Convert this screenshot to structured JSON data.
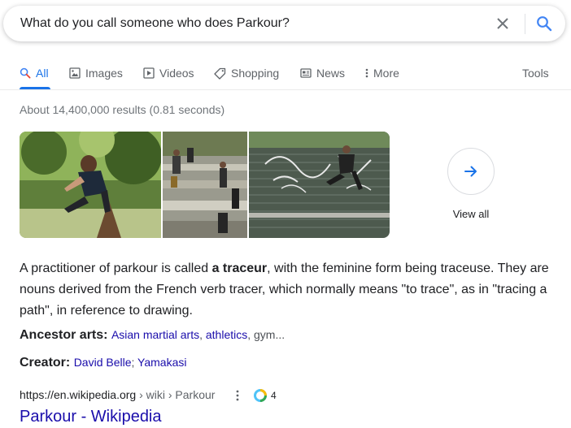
{
  "search": {
    "query": "What do you call someone who does Parkour?"
  },
  "tabs": [
    {
      "label": "All",
      "icon": "search-icon"
    },
    {
      "label": "Images",
      "icon": "image-icon"
    },
    {
      "label": "Videos",
      "icon": "video-icon"
    },
    {
      "label": "Shopping",
      "icon": "tag-icon"
    },
    {
      "label": "News",
      "icon": "news-icon"
    },
    {
      "label": "More",
      "icon": "vertical-dots-icon"
    }
  ],
  "tools_label": "Tools",
  "result_stats": "About 14,400,000 results (0.81 seconds)",
  "images": {
    "view_all_label": "View all"
  },
  "snippet": {
    "before": "A practitioner of parkour is called ",
    "bold": "a traceur",
    "after": ", with the feminine form being traceuse. They are nouns derived from the French verb tracer, which normally means \"to trace\", as in \"tracing a path\", in reference to drawing."
  },
  "ancestor_arts": {
    "label": "Ancestor arts:",
    "links": [
      "Asian martial arts",
      "athletics"
    ],
    "rest": "gym..."
  },
  "creator": {
    "label": "Creator:",
    "links": [
      "David Belle",
      "Yamakasi"
    ]
  },
  "result": {
    "domain": "https://en.wikipedia.org",
    "path": " › wiki › Parkour",
    "badge_count": "4",
    "title": "Parkour - Wikipedia"
  },
  "colors": {
    "link": "#1a0dab",
    "accent": "#1a73e8",
    "muted": "#70757a"
  }
}
